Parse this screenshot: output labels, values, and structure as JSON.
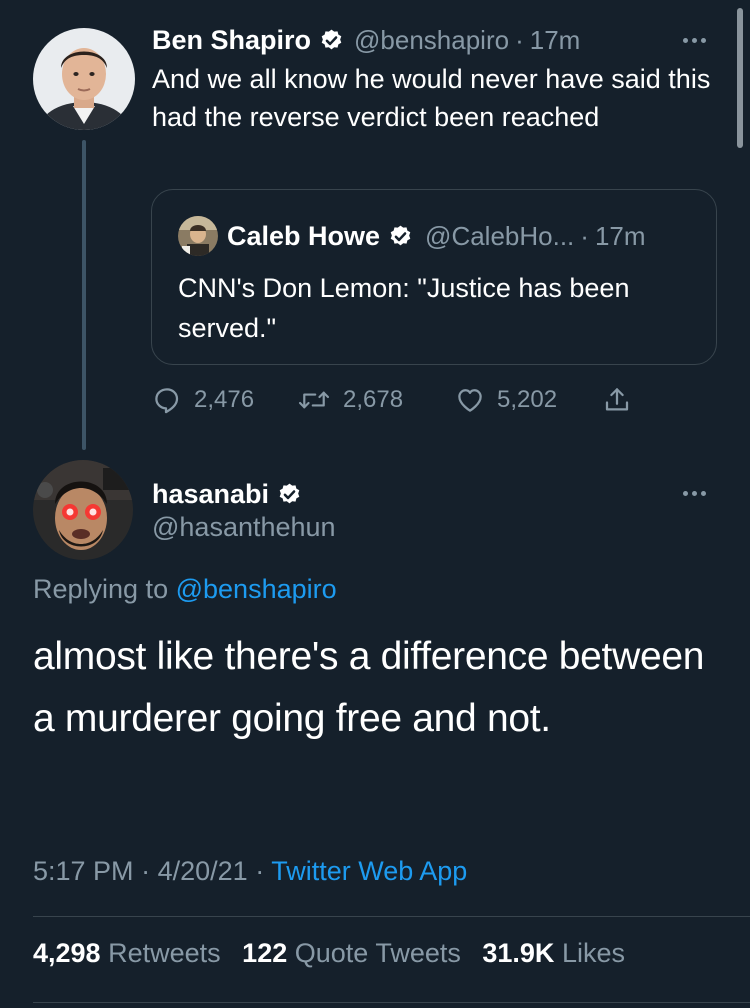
{
  "colors": {
    "background": "#15202b",
    "primary_text": "#ffffff",
    "secondary_text": "#8899a6",
    "link": "#1d9bf0",
    "border": "#38444d"
  },
  "icons": {
    "verified": "verified-badge-icon",
    "more": "more-horizontal-icon",
    "reply": "reply-bubble-icon",
    "retweet": "retweet-icon",
    "like": "heart-icon",
    "share": "share-icon"
  },
  "parent_tweet": {
    "author_name": "Ben Shapiro",
    "handle": "@benshapiro",
    "separator": "·",
    "time": "17m",
    "text": "And we all know he would never have said this had the reverse verdict been reached",
    "quoted_tweet": {
      "author_name": "Caleb Howe",
      "handle": "@CalebHo...",
      "separator": "·",
      "time": "17m",
      "text": "CNN's Don Lemon: \"Justice has been served.\""
    },
    "actions": {
      "replies": "2,476",
      "retweets": "2,678",
      "likes": "5,202"
    }
  },
  "main_tweet": {
    "author_name": "hasanabi",
    "handle": "@hasanthehun",
    "replying_prefix": "Replying to",
    "replying_to": "@benshapiro",
    "text": "almost like there's a difference between a murderer going free and not.",
    "time": "5:17 PM",
    "date": "4/20/21",
    "separator": "·",
    "source": "Twitter Web App",
    "stats": {
      "retweets_count": "4,298",
      "retweets_label": "Retweets",
      "quote_tweets_count": "122",
      "quote_tweets_label": "Quote Tweets",
      "likes_count": "31.9K",
      "likes_label": "Likes"
    }
  }
}
